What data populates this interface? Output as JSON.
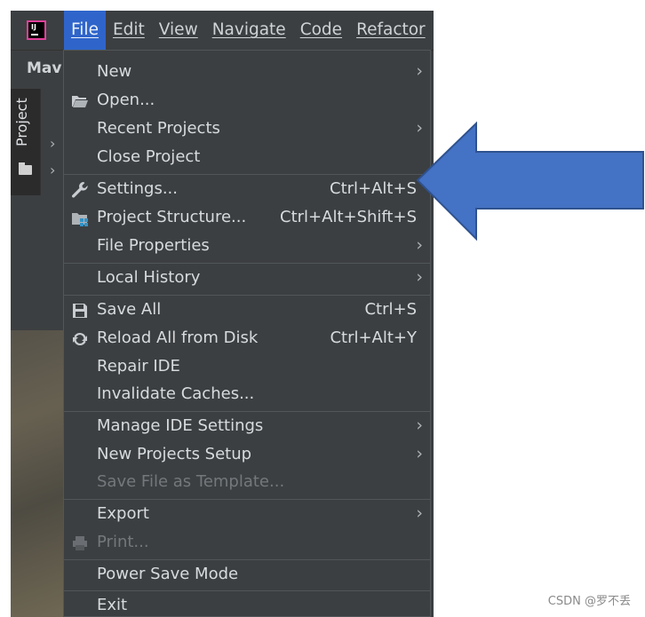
{
  "menubar": {
    "items": [
      {
        "label": "File",
        "active": true
      },
      {
        "label": "Edit",
        "active": false
      },
      {
        "label": "View",
        "active": false
      },
      {
        "label": "Navigate",
        "active": false
      },
      {
        "label": "Code",
        "active": false
      },
      {
        "label": "Refactor",
        "active": false
      }
    ]
  },
  "toolbar": {
    "crumb": "Mav"
  },
  "sidebar": {
    "project_tab": "Project"
  },
  "file_menu": {
    "items": [
      {
        "label": "New",
        "shortcut": "",
        "submenu": true,
        "enabled": true,
        "icon": ""
      },
      {
        "label": "Open...",
        "shortcut": "",
        "submenu": false,
        "enabled": true,
        "icon": "folder-open-icon"
      },
      {
        "label": "Recent Projects",
        "shortcut": "",
        "submenu": true,
        "enabled": true,
        "icon": ""
      },
      {
        "label": "Close Project",
        "shortcut": "",
        "submenu": false,
        "enabled": true,
        "icon": ""
      },
      {
        "label": "Settings...",
        "shortcut": "Ctrl+Alt+S",
        "submenu": false,
        "enabled": true,
        "icon": "wrench-icon"
      },
      {
        "label": "Project Structure...",
        "shortcut": "Ctrl+Alt+Shift+S",
        "submenu": false,
        "enabled": true,
        "icon": "project-structure-icon"
      },
      {
        "label": "File Properties",
        "shortcut": "",
        "submenu": true,
        "enabled": true,
        "icon": ""
      },
      {
        "label": "Local History",
        "shortcut": "",
        "submenu": true,
        "enabled": true,
        "icon": ""
      },
      {
        "label": "Save All",
        "shortcut": "Ctrl+S",
        "submenu": false,
        "enabled": true,
        "icon": "save-icon"
      },
      {
        "label": "Reload All from Disk",
        "shortcut": "Ctrl+Alt+Y",
        "submenu": false,
        "enabled": true,
        "icon": "reload-icon"
      },
      {
        "label": "Repair IDE",
        "shortcut": "",
        "submenu": false,
        "enabled": true,
        "icon": ""
      },
      {
        "label": "Invalidate Caches...",
        "shortcut": "",
        "submenu": false,
        "enabled": true,
        "icon": ""
      },
      {
        "label": "Manage IDE Settings",
        "shortcut": "",
        "submenu": true,
        "enabled": true,
        "icon": ""
      },
      {
        "label": "New Projects Setup",
        "shortcut": "",
        "submenu": true,
        "enabled": true,
        "icon": ""
      },
      {
        "label": "Save File as Template...",
        "shortcut": "",
        "submenu": false,
        "enabled": false,
        "icon": ""
      },
      {
        "label": "Export",
        "shortcut": "",
        "submenu": true,
        "enabled": true,
        "icon": ""
      },
      {
        "label": "Print...",
        "shortcut": "",
        "submenu": false,
        "enabled": false,
        "icon": "print-icon"
      },
      {
        "label": "Power Save Mode",
        "shortcut": "",
        "submenu": false,
        "enabled": true,
        "icon": ""
      },
      {
        "label": "Exit",
        "shortcut": "",
        "submenu": false,
        "enabled": true,
        "icon": ""
      }
    ],
    "submenu_glyph": "›"
  },
  "annotation": {
    "arrow_color": "#4472c4",
    "arrow_border": "#2f528f"
  },
  "watermark": "CSDN @罗不丢"
}
